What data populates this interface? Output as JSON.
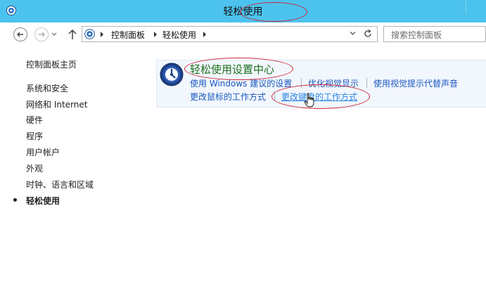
{
  "window": {
    "title": "轻松使用"
  },
  "address_bar": {
    "crumbs": [
      "控制面板",
      "轻松使用"
    ]
  },
  "search": {
    "placeholder": "搜索控制面板"
  },
  "sidebar": {
    "home_label": "控制面板主页",
    "items": [
      {
        "label": "系统和安全"
      },
      {
        "label": "网络和 Internet"
      },
      {
        "label": "硬件"
      },
      {
        "label": "程序"
      },
      {
        "label": "用户帐户"
      },
      {
        "label": "外观"
      },
      {
        "label": "时钟、语言和区域"
      },
      {
        "label": "轻松使用",
        "current": true
      }
    ]
  },
  "main": {
    "section": {
      "title": "轻松使用设置中心",
      "links": [
        {
          "label": "使用 Windows 建议的设置"
        },
        {
          "label": "优化视觉显示"
        },
        {
          "label": "使用视觉提示代替声音"
        },
        {
          "label": "更改鼠标的工作方式"
        },
        {
          "label": "更改键盘的工作方式",
          "hover": true
        }
      ]
    }
  },
  "colors": {
    "titlebar": "#4cc3ee",
    "heading_green": "#1f6e1f",
    "link_blue": "#1a55c0",
    "annotation_red": "#d0243a"
  },
  "icons": [
    "control-panel-icon",
    "back-arrow-icon",
    "forward-arrow-icon",
    "up-arrow-icon",
    "chevron-down-icon",
    "refresh-icon",
    "ease-of-access-icon",
    "hand-pointer-icon"
  ]
}
